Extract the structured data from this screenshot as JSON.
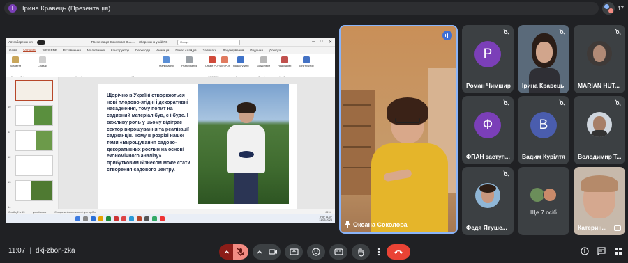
{
  "meeting": {
    "presenter_initial": "І",
    "presentation_title": "Ірина Кравець (Презентація)",
    "participant_count": "17",
    "time": "11:07",
    "meeting_code": "dkj-zbon-zka"
  },
  "ppt": {
    "autosave": "Автозбереження",
    "filename": "Презентація Соколової О.А....",
    "saved_state": "Збережено у цій ПК",
    "search_placeholder": "Пошук",
    "menus": [
      "Файл",
      "Основне",
      "WPS PDF",
      "Вставлення",
      "Малювання",
      "Конструктор",
      "Переходи",
      "Анімація",
      "Показ слайдів",
      "Записати",
      "Рецензування",
      "Подання",
      "Довідка"
    ],
    "active_menu": "Основне",
    "ribbon_buttons": [
      "Вставити",
      "Слайди",
      "Малювання",
      "Редагування",
      "Create PDF",
      "Sign PDF",
      "Надиктувати",
      "Дизайнери",
      "Надбудови",
      "Конструктор"
    ],
    "ribbon_groups": [
      "Буфер обміну",
      "Шрифт",
      "Абзац",
      "WPS PDF",
      "Голос",
      "Дизайнер",
      "Надбудови"
    ],
    "slide_numbers": [
      "10",
      "11",
      "12",
      "13",
      "14"
    ],
    "slide_text": "Щорічно в Україні створюються нові плодово-ягідні і декоративні насадження, тому попит на садивний матеріал був, є і буде. І важливу роль у цьому відіграє сектор вирощування та реалізації саджанців. Тому в розрізі нашої теми «Вирощування садово-декоративних рослин на основі економічного аналізу» прибутковим бізнесом може стати створення садового центру.",
    "status_left": "Слайд 2 із 15",
    "status_lang": "українська",
    "status_access": "Спеціальні можливості: усе добре",
    "zoom": "61%",
    "tray_lang": "УКР",
    "tray_time": "11:07",
    "tray_date": "11.03.2026"
  },
  "speaker": {
    "name": "Оксана Соколова"
  },
  "participants": [
    {
      "name": "Роман Чимшир",
      "initial": "Р",
      "color": "#7b3fb8",
      "type": "letter"
    },
    {
      "name": "Ірина Кравець",
      "type": "photo"
    },
    {
      "name": "MARIAN HUT...",
      "type": "photo"
    },
    {
      "name": "ФПАН заступ...",
      "initial": "Ф",
      "color": "#7b3fb8",
      "type": "letter"
    },
    {
      "name": "Вадим Курілтя",
      "initial": "В",
      "color": "#4a5dae",
      "type": "letter"
    },
    {
      "name": "Володимир Т...",
      "type": "photo"
    },
    {
      "name": "Федя Ятуше...",
      "type": "photo"
    },
    {
      "name": "Ще 7 осіб",
      "type": "group"
    },
    {
      "name": "Катерин...",
      "type": "photo"
    }
  ],
  "controls": {
    "icons": [
      "chevron-up-icon",
      "mic-off-icon",
      "chevron-up-icon",
      "camera-icon",
      "present-icon",
      "emoji-icon",
      "captions-icon",
      "raise-hand-icon",
      "more-icon",
      "end-call-icon"
    ],
    "right_icons": [
      "info-icon",
      "chat-icon",
      "activities-icon"
    ]
  }
}
